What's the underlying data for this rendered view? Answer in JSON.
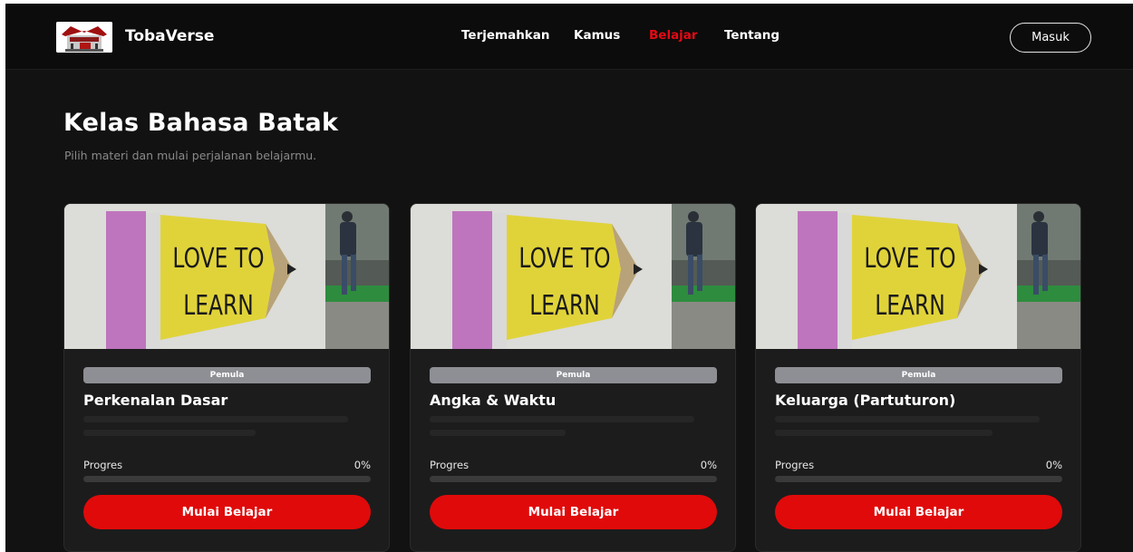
{
  "brand": {
    "name": "TobaVerse"
  },
  "nav": {
    "links": [
      {
        "label": "Terjemahkan",
        "active": false
      },
      {
        "label": "Kamus",
        "active": false
      },
      {
        "label": "Belajar",
        "active": true
      },
      {
        "label": "Tentang",
        "active": false
      }
    ],
    "login_label": "Masuk"
  },
  "header": {
    "title": "Kelas Bahasa Batak",
    "subtitle": "Pilih materi dan mulai perjalanan belajarmu."
  },
  "courses": [
    {
      "image_text_1": "LOVE TO",
      "image_text_2": "LEARN",
      "level": "Pemula",
      "title": "Perkenalan Dasar",
      "progress_label": "Progres",
      "progress_value": "0%",
      "progress_fraction": 0,
      "button_label": "Mulai Belajar"
    },
    {
      "image_text_1": "LOVE TO",
      "image_text_2": "LEARN",
      "level": "Pemula",
      "title": "Angka & Waktu",
      "progress_label": "Progres",
      "progress_value": "0%",
      "progress_fraction": 0,
      "button_label": "Mulai Belajar"
    },
    {
      "image_text_1": "LOVE TO",
      "image_text_2": "LEARN",
      "level": "Pemula",
      "title": "Keluarga (Partuturon)",
      "progress_label": "Progres",
      "progress_value": "0%",
      "progress_fraction": 0,
      "button_label": "Mulai Belajar"
    }
  ],
  "colors": {
    "accent": "#e50914",
    "background": "#121212",
    "card": "#1c1c1c",
    "badge": "#8d8f95"
  }
}
